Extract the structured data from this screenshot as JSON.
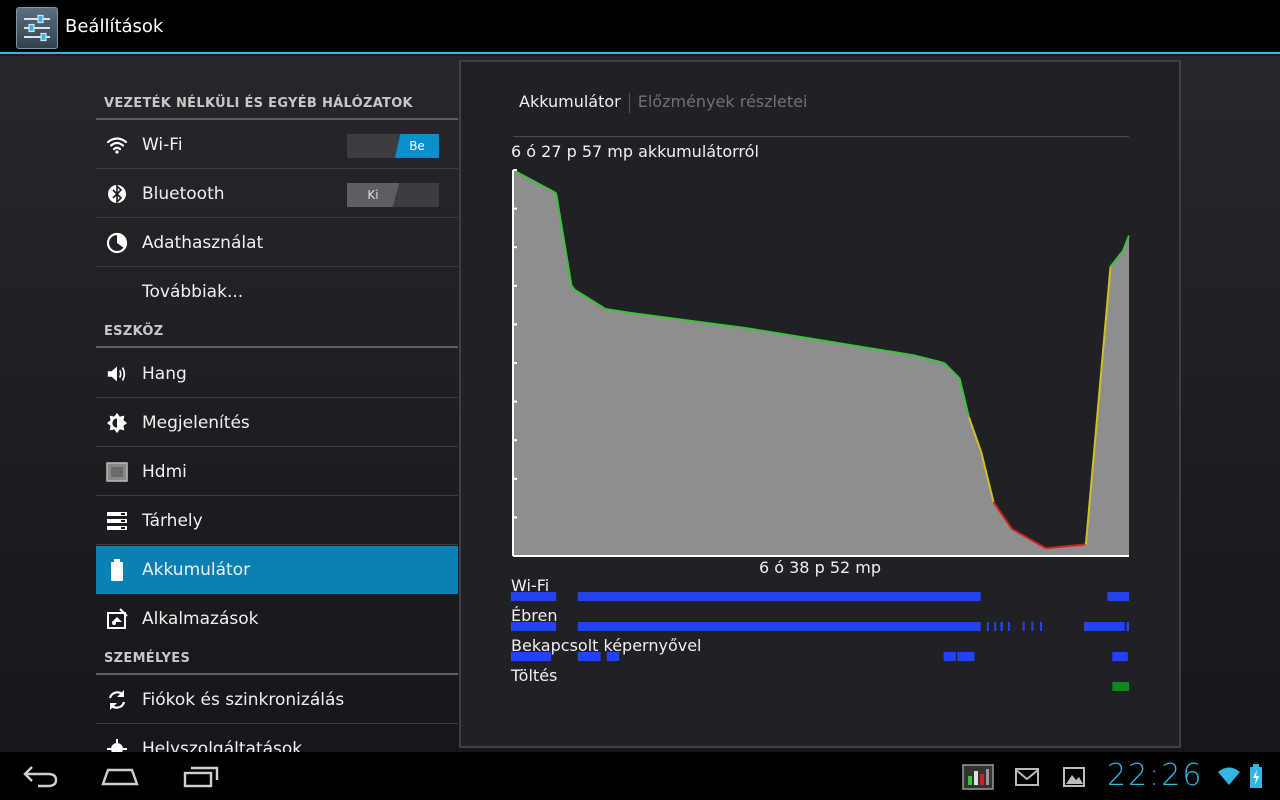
{
  "app": {
    "title": "Beállítások",
    "icon": "settings-sliders-icon"
  },
  "sidebar": {
    "sections": [
      {
        "header": "VEZETÉK NÉLKÜLI ÉS EGYÉB HÁLÓZATOK",
        "items": [
          {
            "label": "Wi-Fi",
            "icon": "wifi-icon",
            "toggle": "Be",
            "toggle_state": "on"
          },
          {
            "label": "Bluetooth",
            "icon": "bluetooth-icon",
            "toggle": "Ki",
            "toggle_state": "off"
          },
          {
            "label": "Adathasználat",
            "icon": "data-usage-icon"
          },
          {
            "label": "Továbbiak..."
          }
        ]
      },
      {
        "header": "ESZKÖZ",
        "items": [
          {
            "label": "Hang",
            "icon": "speaker-icon"
          },
          {
            "label": "Megjelenítés",
            "icon": "brightness-icon"
          },
          {
            "label": "Hdmi",
            "icon": "hdmi-icon"
          },
          {
            "label": "Tárhely",
            "icon": "storage-icon"
          },
          {
            "label": "Akkumulátor",
            "icon": "battery-icon",
            "selected": true
          },
          {
            "label": "Alkalmazások",
            "icon": "apps-icon"
          }
        ]
      },
      {
        "header": "SZEMÉLYES",
        "items": [
          {
            "label": "Fiókok és szinkronizálás",
            "icon": "sync-icon"
          },
          {
            "label": "Helyszolgáltatások",
            "icon": "location-icon"
          }
        ]
      }
    ]
  },
  "detail": {
    "tabs": [
      "Akkumulátor",
      "Előzmények részletei"
    ],
    "on_battery": "6 ó 27 p 57 mp akkumulátorról",
    "duration": "6 ó 38 p 52 mp",
    "timelines": [
      "Wi-Fi",
      "Ébren",
      "Bekapcsolt képernyővel",
      "Töltés"
    ]
  },
  "chart_data": {
    "type": "area",
    "title": "6 ó 27 p 57 mp akkumulátorról",
    "xlabel": "6 ó 38 p 52 mp",
    "ylim": [
      0,
      100
    ],
    "xlim": [
      0,
      100
    ],
    "grid": false,
    "x": [
      0,
      7,
      9.5,
      10,
      12,
      15,
      19,
      38,
      65,
      70,
      72.5,
      74,
      76,
      78,
      81,
      86.5,
      93,
      97,
      99,
      100
    ],
    "y": [
      100,
      94,
      70,
      69,
      67,
      64,
      63,
      59,
      52,
      50,
      46,
      36,
      27,
      14,
      7,
      2,
      3,
      75,
      79,
      83
    ],
    "level_colors": {
      "high": "#3ac23a",
      "mid": "#d0c020",
      "low": "#d02020"
    },
    "colors": {
      "fill": "#8e8e8e",
      "axis": "#ffffff"
    }
  },
  "timeline_data": {
    "wifi": [
      [
        0,
        7.3
      ],
      [
        10.8,
        76
      ],
      [
        96.5,
        100
      ]
    ],
    "awake": [
      [
        0,
        7.3
      ],
      [
        10.8,
        76
      ],
      [
        77,
        77.3
      ],
      [
        78.2,
        78.5
      ],
      [
        79.2,
        79.6
      ],
      [
        80.4,
        80.7
      ],
      [
        82.8,
        83.1
      ],
      [
        84.2,
        84.5
      ],
      [
        85.6,
        85.9
      ],
      [
        92.7,
        99.3
      ],
      [
        99.6,
        100
      ]
    ],
    "screen_on": [
      [
        0,
        6.5
      ],
      [
        10.8,
        14.5
      ],
      [
        15.5,
        17.5
      ],
      [
        70,
        72
      ],
      [
        72.2,
        75
      ],
      [
        97.3,
        99.8
      ]
    ],
    "charging": [
      [
        97.3,
        100
      ]
    ],
    "colors": {
      "bar": "#2244ee",
      "charging": "#0a8a1c"
    }
  },
  "system_bar": {
    "clock": "22:26",
    "notification_icons": [
      "status-chart-icon",
      "gmail-icon",
      "gallery-icon"
    ],
    "status_icons": [
      "wifi-signal-icon",
      "battery-charging-icon"
    ],
    "nav": [
      "back-icon",
      "home-icon",
      "recent-apps-icon"
    ],
    "accent": "#33b5e5"
  }
}
